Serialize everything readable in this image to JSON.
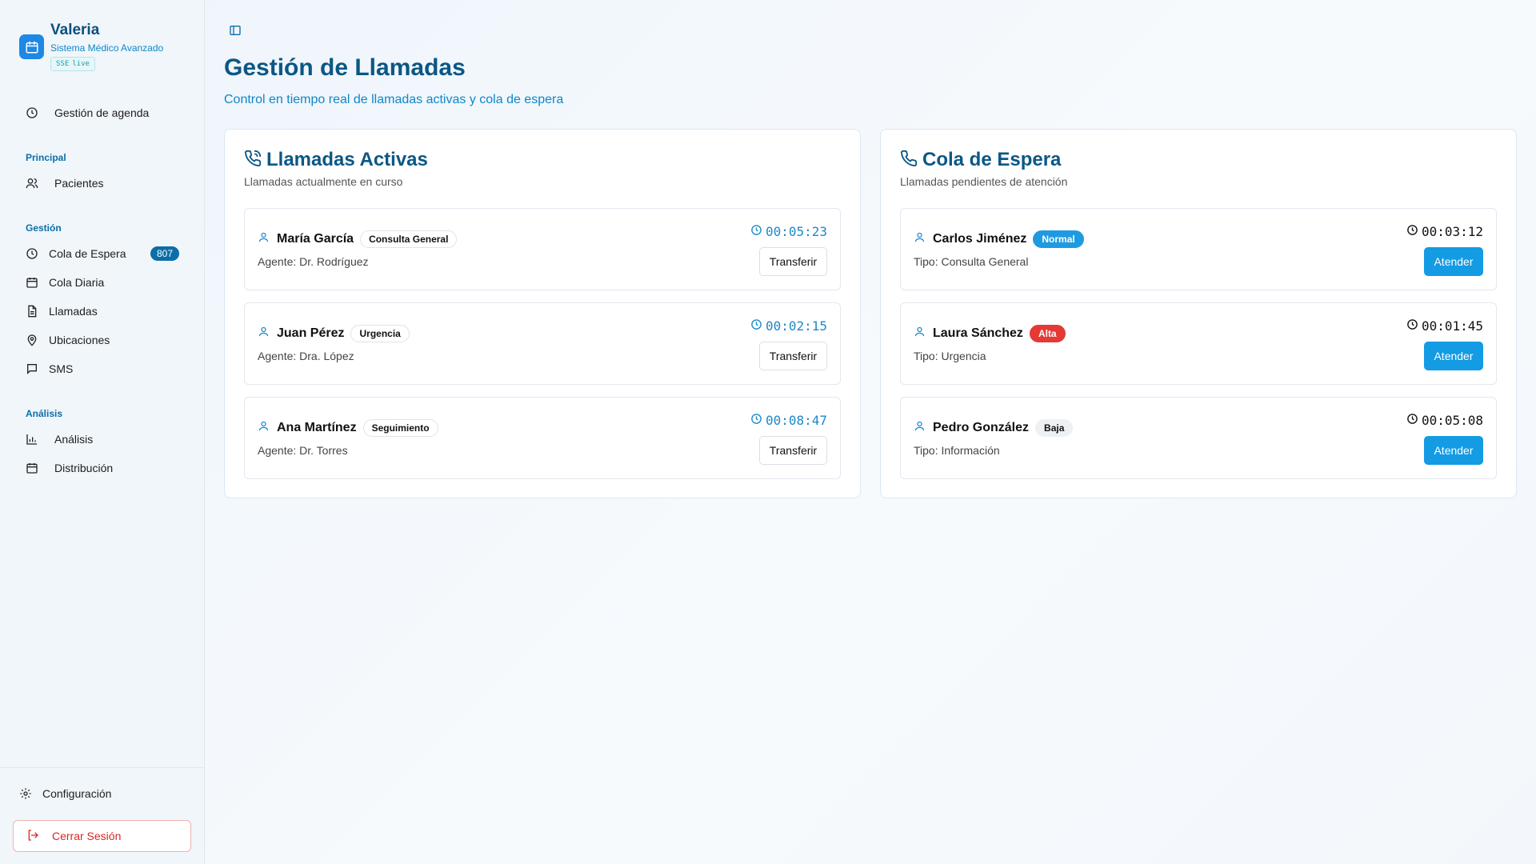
{
  "brand": {
    "title": "Valeria",
    "subtitle": "Sistema Médico Avanzado",
    "badge_sse": "SSE",
    "badge_live": "live"
  },
  "nav": {
    "top_item": {
      "label": "Gestión de agenda",
      "icon": "clock-icon"
    },
    "sections": [
      {
        "title": "Principal",
        "items": [
          {
            "label": "Pacientes",
            "icon": "users-icon"
          }
        ]
      },
      {
        "title": "Gestión",
        "items": [
          {
            "label": "Cola de Espera",
            "icon": "clock-icon",
            "count": "807"
          },
          {
            "label": "Cola Diaria",
            "icon": "calendar-icon"
          },
          {
            "label": "Llamadas",
            "icon": "file-icon"
          },
          {
            "label": "Ubicaciones",
            "icon": "map-pin-icon"
          },
          {
            "label": "SMS",
            "icon": "message-icon"
          }
        ]
      },
      {
        "title": "Análisis",
        "items": [
          {
            "label": "Análisis",
            "icon": "bar-chart-icon"
          },
          {
            "label": "Distribución",
            "icon": "calendar-icon"
          }
        ]
      }
    ],
    "settings": "Configuración",
    "logout": "Cerrar Sesión"
  },
  "page": {
    "title": "Gestión de Llamadas",
    "subtitle": "Control en tiempo real de llamadas activas y cola de espera"
  },
  "active_calls": {
    "title": "Llamadas Activas",
    "description": "Llamadas actualmente en curso",
    "button_label": "Transferir",
    "calls": [
      {
        "name": "María García",
        "type": "Consulta General",
        "agent": "Agente: Dr. Rodríguez",
        "duration": "00:05:23"
      },
      {
        "name": "Juan Pérez",
        "type": "Urgencia",
        "agent": "Agente: Dra. López",
        "duration": "00:02:15"
      },
      {
        "name": "Ana Martínez",
        "type": "Seguimiento",
        "agent": "Agente: Dr. Torres",
        "duration": "00:08:47"
      }
    ]
  },
  "queue": {
    "title": "Cola de Espera",
    "description": "Llamadas pendientes de atención",
    "button_label": "Atender",
    "calls": [
      {
        "name": "Carlos Jiménez",
        "priority": "Normal",
        "type": "Tipo: Consulta General",
        "wait": "00:03:12"
      },
      {
        "name": "Laura Sánchez",
        "priority": "Alta",
        "type": "Tipo: Urgencia",
        "wait": "00:01:45"
      },
      {
        "name": "Pedro González",
        "priority": "Baja",
        "type": "Tipo: Información",
        "wait": "00:05:08"
      }
    ]
  },
  "colors": {
    "accent": "#0b5785",
    "primary_button": "#139be3",
    "danger": "#dc2626"
  }
}
